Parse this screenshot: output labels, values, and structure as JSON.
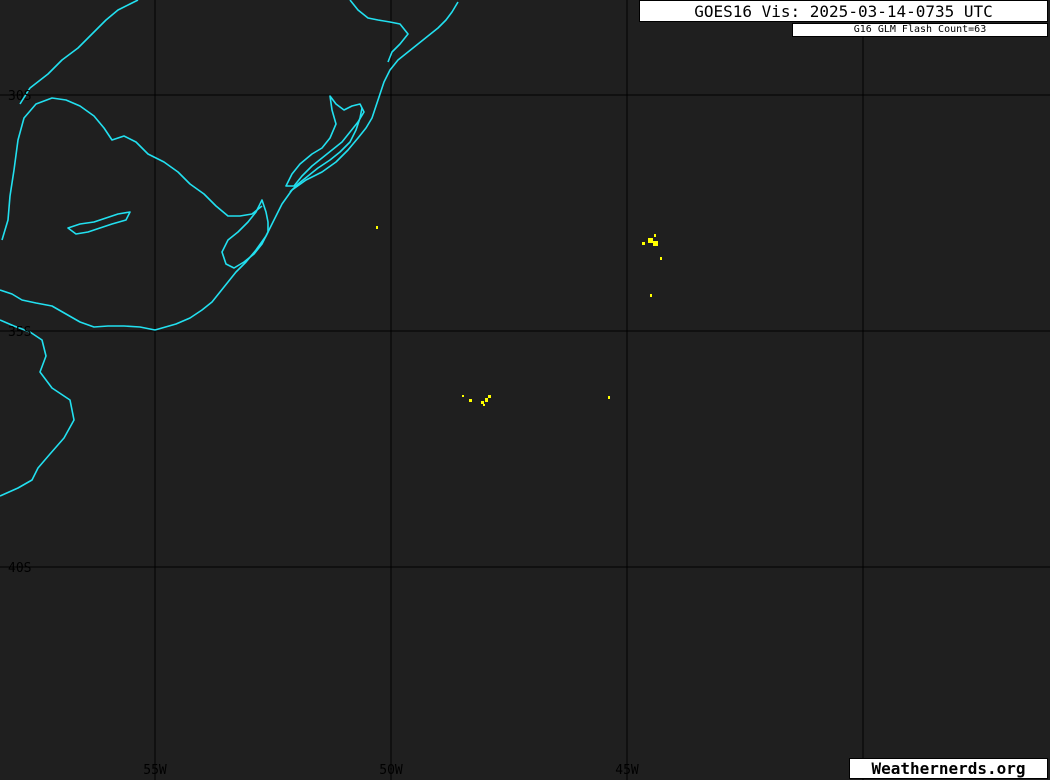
{
  "header": {
    "title": "GOES16 Vis: 2025-03-14-0735 UTC",
    "subtitle": "G16 GLM Flash Count=63"
  },
  "footer": {
    "brand": "Weathernerds.org"
  },
  "map": {
    "colors": {
      "background": "#1f1f1f",
      "coastline": "#22e0f0",
      "grid": "#000000",
      "lightning": "#ffff00"
    },
    "lat_labels": [
      "30S",
      "35S",
      "40S"
    ],
    "lon_labels": [
      "55W",
      "50W",
      "45W"
    ],
    "flash_clusters": [
      {
        "lon": -50.3,
        "lat": -32.8,
        "count": 1
      },
      {
        "lon": -44.5,
        "lat": -33.1,
        "count": 6
      },
      {
        "lon": -44.5,
        "lat": -34.3,
        "count": 1
      },
      {
        "lon": -47.7,
        "lat": -36.5,
        "count": 7
      },
      {
        "lon": -45.4,
        "lat": -36.4,
        "count": 1
      }
    ]
  }
}
